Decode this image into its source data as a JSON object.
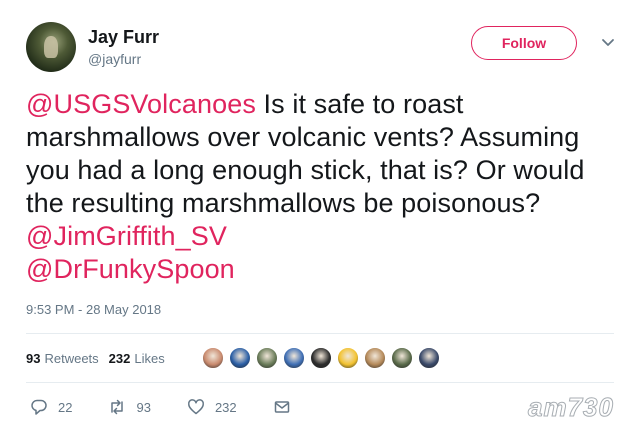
{
  "user": {
    "display_name": "Jay Furr",
    "handle": "@jayfurr",
    "follow_label": "Follow"
  },
  "tweet": {
    "mention_1": "@USGSVolcanoes",
    "text_1": " Is it safe to roast marshmallows over volcanic vents?  Assuming you had a long enough stick, that is?  Or would the resulting marshmallows be poisonous?  ",
    "mention_2": "@JimGriffith_SV",
    "mention_3": "@DrFunkySpoon",
    "timestamp": "9:53 PM - 28 May 2018"
  },
  "stats": {
    "retweets_count": "93",
    "retweets_label": "Retweets",
    "likes_count": "232",
    "likes_label": "Likes"
  },
  "likers": [
    {
      "color": "#c98a6e"
    },
    {
      "color": "#2b5fa6"
    },
    {
      "color": "#6b7d5a"
    },
    {
      "color": "#3f6fb5"
    },
    {
      "color": "#2d2d2d"
    },
    {
      "color": "#f2c230"
    },
    {
      "color": "#b58a5a"
    },
    {
      "color": "#5a6b4a"
    },
    {
      "color": "#3a4a6a"
    }
  ],
  "actions": {
    "replies": "22",
    "retweets": "93",
    "likes": "232"
  },
  "icons": {
    "caret": "chevron-down-icon",
    "reply": "reply-icon",
    "retweet": "retweet-icon",
    "like": "heart-icon",
    "message": "envelope-icon"
  },
  "colors": {
    "accent": "#e0245e",
    "secondary_text": "#657786",
    "primary_text": "#14171a"
  },
  "watermark": "am730"
}
